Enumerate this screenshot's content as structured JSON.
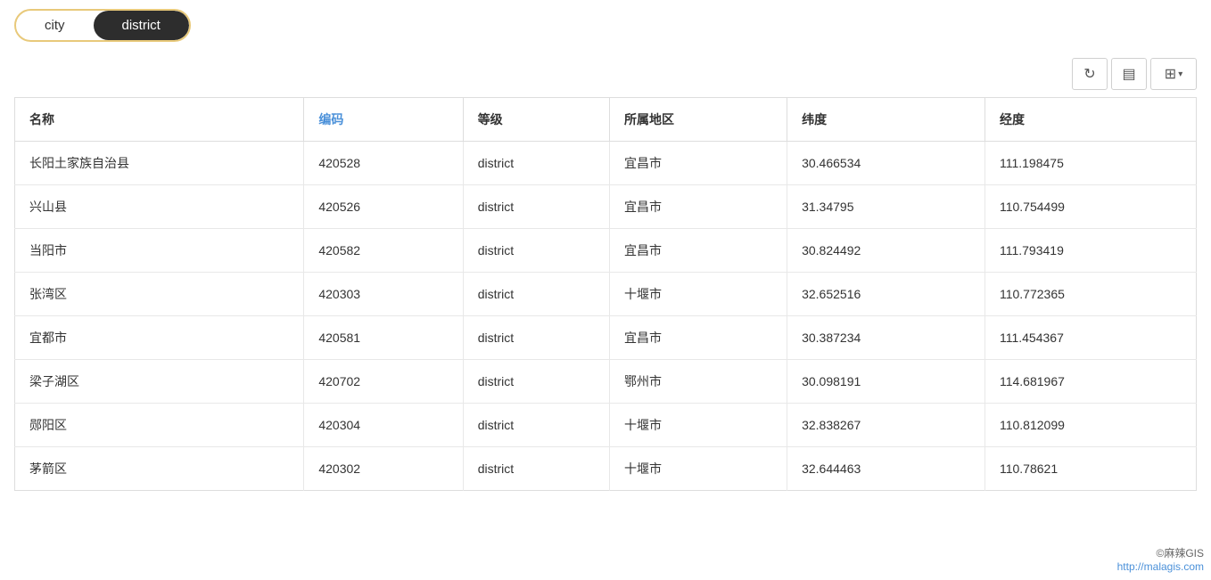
{
  "tabs": [
    {
      "label": "city",
      "active": false
    },
    {
      "label": "district",
      "active": true
    }
  ],
  "toolbar": {
    "refresh_icon": "↻",
    "table_icon": "☰",
    "grid_icon": "⊞",
    "caret_icon": "▾"
  },
  "table": {
    "columns": [
      {
        "key": "name",
        "label": "名称",
        "highlighted": false
      },
      {
        "key": "code",
        "label": "编码",
        "highlighted": true
      },
      {
        "key": "level",
        "label": "等级",
        "highlighted": false
      },
      {
        "key": "region",
        "label": "所属地区",
        "highlighted": false
      },
      {
        "key": "lat",
        "label": "纬度",
        "highlighted": false
      },
      {
        "key": "lng",
        "label": "经度",
        "highlighted": false
      }
    ],
    "rows": [
      {
        "name": "长阳土家族自治县",
        "code": "420528",
        "level": "district",
        "region": "宜昌市",
        "lat": "30.466534",
        "lng": "111.198475"
      },
      {
        "name": "兴山县",
        "code": "420526",
        "level": "district",
        "region": "宜昌市",
        "lat": "31.34795",
        "lng": "110.754499"
      },
      {
        "name": "当阳市",
        "code": "420582",
        "level": "district",
        "region": "宜昌市",
        "lat": "30.824492",
        "lng": "111.793419"
      },
      {
        "name": "张湾区",
        "code": "420303",
        "level": "district",
        "region": "十堰市",
        "lat": "32.652516",
        "lng": "110.772365"
      },
      {
        "name": "宜都市",
        "code": "420581",
        "level": "district",
        "region": "宜昌市",
        "lat": "30.387234",
        "lng": "111.454367"
      },
      {
        "name": "梁子湖区",
        "code": "420702",
        "level": "district",
        "region": "鄂州市",
        "lat": "30.098191",
        "lng": "114.681967"
      },
      {
        "name": "郧阳区",
        "code": "420304",
        "level": "district",
        "region": "十堰市",
        "lat": "32.838267",
        "lng": "110.812099"
      },
      {
        "name": "茅箭区",
        "code": "420302",
        "level": "district",
        "region": "十堰市",
        "lat": "32.644463",
        "lng": "110.78621"
      }
    ]
  },
  "watermark": {
    "line1": "©麻辣GIS",
    "line2": "http://malagis.com"
  }
}
